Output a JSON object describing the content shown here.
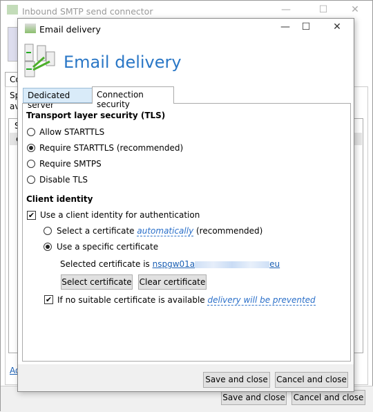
{
  "back_window": {
    "title": "Inbound SMTP send connector",
    "tab_partial": "Co",
    "text_partial_1": "Sp",
    "text_partial_2": "ava",
    "list_header_partial": "S",
    "list_row_partial": "e",
    "link_partial": "Ad",
    "save_label": "Save and close",
    "cancel_label": "Cancel and close"
  },
  "dialog": {
    "title": "Email delivery",
    "header": "Email delivery",
    "tabs": [
      {
        "label": "Dedicated server",
        "active": false
      },
      {
        "label": "Connection security",
        "active": true
      }
    ],
    "tls": {
      "heading": "Transport layer security (TLS)",
      "options": [
        "Allow STARTTLS",
        "Require STARTTLS (recommended)",
        "Require SMTPS",
        "Disable TLS"
      ],
      "selected": "Require STARTTLS (recommended)"
    },
    "client": {
      "heading": "Client identity",
      "use_identity_label": "Use a client identity for authentication",
      "use_identity_checked": true,
      "auto_prefix": "Select a certificate ",
      "auto_link": "automatically",
      "auto_suffix": " (recommended)",
      "specific_label": "Use a specific certificate",
      "selected_mode": "specific",
      "cert_prefix": "Selected certificate is ",
      "cert_start": "nspgw01a",
      "cert_end": "eu",
      "select_btn": "Select certificate",
      "clear_btn": "Clear certificate",
      "fallback_prefix": "If no suitable certificate is available ",
      "fallback_link": "delivery will be prevented",
      "fallback_checked": true
    },
    "save_label": "Save and close",
    "cancel_label": "Cancel and close"
  }
}
